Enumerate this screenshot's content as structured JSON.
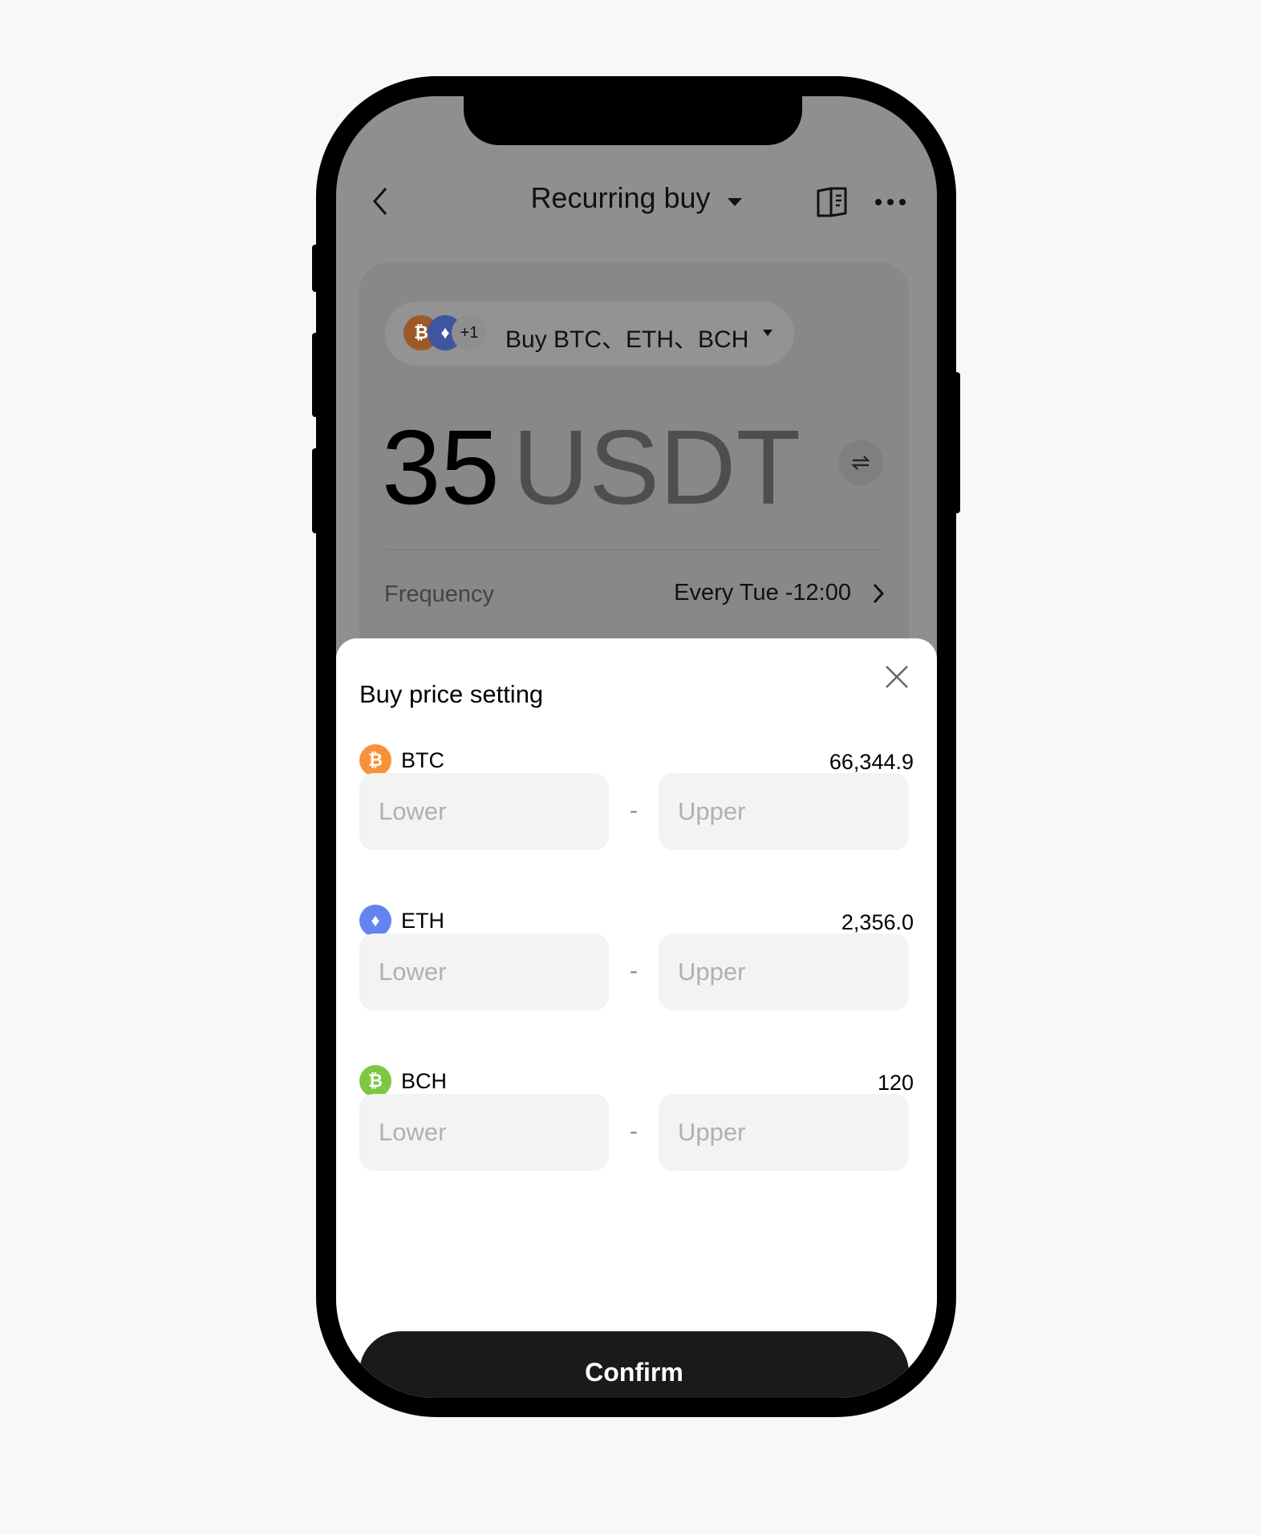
{
  "header": {
    "title": "Recurring buy"
  },
  "card": {
    "pill_label": "Buy BTC、ETH、BCH",
    "extra_count": "+1",
    "amount": "35",
    "currency": "USDT",
    "frequency_label": "Frequency",
    "frequency_value": "Every Tue -12:00"
  },
  "sheet": {
    "title": "Buy price setting",
    "rows": [
      {
        "symbol": "BTC",
        "price": "66,344.9",
        "color": "#f7923b",
        "lower_placeholder": "Lower",
        "upper_placeholder": "Upper"
      },
      {
        "symbol": "ETH",
        "price": "2,356.0",
        "color": "#6384f0",
        "lower_placeholder": "Lower",
        "upper_placeholder": "Upper"
      },
      {
        "symbol": "BCH",
        "price": "120",
        "color": "#7dc843",
        "lower_placeholder": "Lower",
        "upper_placeholder": "Upper"
      }
    ],
    "separator": "-",
    "confirm_label": "Confirm"
  }
}
